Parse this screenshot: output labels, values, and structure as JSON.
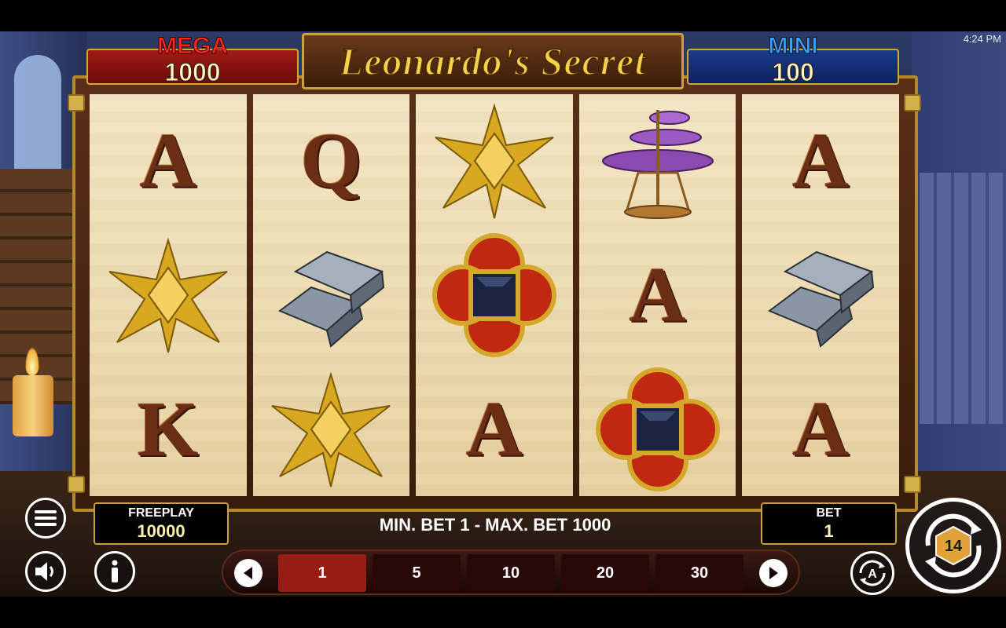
{
  "status_bar": {
    "time": "4:24 PM"
  },
  "game": {
    "title": "Leonardo's Secret"
  },
  "jackpots": {
    "mega": {
      "label": "MEGA",
      "value": "1000"
    },
    "mini": {
      "label": "MINI",
      "value": "100"
    }
  },
  "reels": [
    [
      "A",
      "golden-star-icon",
      "K"
    ],
    [
      "Q",
      "silver-ingots-icon",
      "golden-star-icon"
    ],
    [
      "golden-star-icon",
      "ruby-jewel-icon",
      "A"
    ],
    [
      "flying-machine-icon",
      "A",
      "ruby-jewel-icon"
    ],
    [
      "A",
      "silver-ingots-icon",
      "A"
    ]
  ],
  "freeplay": {
    "label": "FREEPLAY",
    "value": "10000"
  },
  "bet": {
    "label": "BET",
    "value": "1"
  },
  "bet_limits": "MIN. BET 1 - MAX. BET 1000",
  "bet_options": [
    "1",
    "5",
    "10",
    "20",
    "30"
  ],
  "selected_bet_index": 0,
  "spin_button": {
    "digits": "14"
  },
  "auto_button": {
    "label": "A"
  },
  "colors": {
    "mega": "#a11a14",
    "mini": "#1a3a8a",
    "active_bet": "#9a1a14",
    "gold_border": "#c9a13b"
  }
}
